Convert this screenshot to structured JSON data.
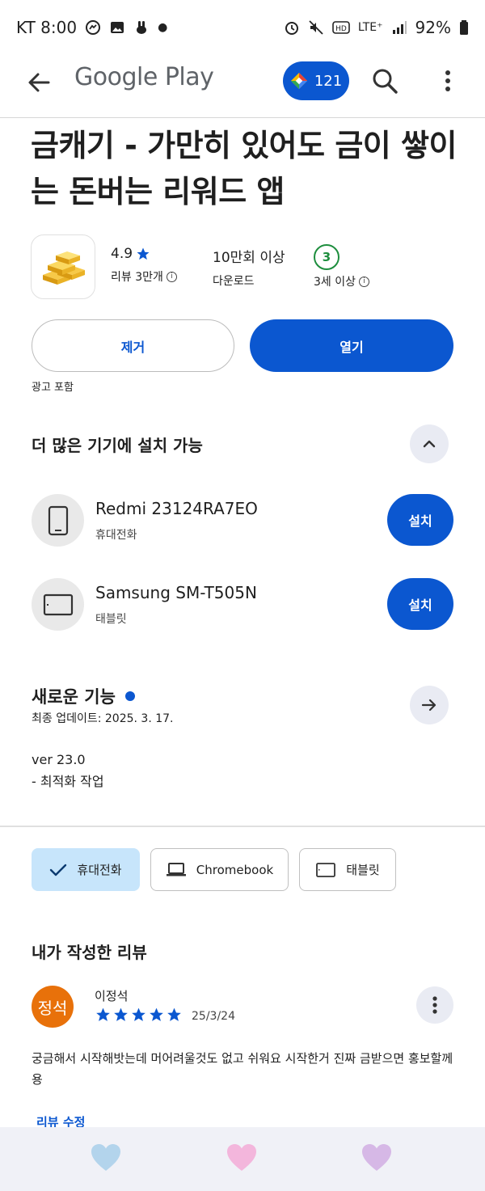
{
  "status": {
    "carrier_time": "KT 8:00",
    "network": "LTE⁺",
    "battery": "92%"
  },
  "appbar": {
    "brand": "Google Play",
    "points": "121"
  },
  "app": {
    "title": "금캐기 - 가만히 있어도 금이 쌓이는 돈버는 리워드 앱",
    "rating": "4.9",
    "rating_label": "리뷰 3만개",
    "downloads": "10만회 이상",
    "downloads_label": "다운로드",
    "age_badge": "3",
    "age_label": "3세 이상",
    "remove_label": "제거",
    "open_label": "열기",
    "ads_label": "광고 포함"
  },
  "devices": {
    "title": "더 많은 기기에 설치 가능",
    "items": [
      {
        "name": "Redmi 23124RA7EO",
        "type": "휴대전화",
        "action": "설치"
      },
      {
        "name": "Samsung SM-T505N",
        "type": "태블릿",
        "action": "설치"
      }
    ]
  },
  "whats_new": {
    "title": "새로운 기능",
    "updated": "최종 업데이트: 2025. 3. 17.",
    "version": "ver 23.0",
    "note": "- 최적화 작업"
  },
  "chips": [
    {
      "label": "휴대전화",
      "selected": true
    },
    {
      "label": "Chromebook",
      "selected": false
    },
    {
      "label": "태블릿",
      "selected": false
    }
  ],
  "review": {
    "section_title": "내가 작성한 리뷰",
    "avatar_text": "정석",
    "author": "이정석",
    "stars": 5,
    "date": "25/3/24",
    "text": "궁금해서 시작해밧는데 머어려울것도 없고 쉬워요 시작한거 진짜 금받으면 홍보할께용",
    "edit_label": "리뷰 수정"
  },
  "colors": {
    "accent": "#0b57d0",
    "age_green": "#1e8e3e",
    "avatar_orange": "#e8710a",
    "heart_blue": "#b3d4ec",
    "heart_pink": "#f3b6dc",
    "heart_purple": "#d6b8e6"
  }
}
